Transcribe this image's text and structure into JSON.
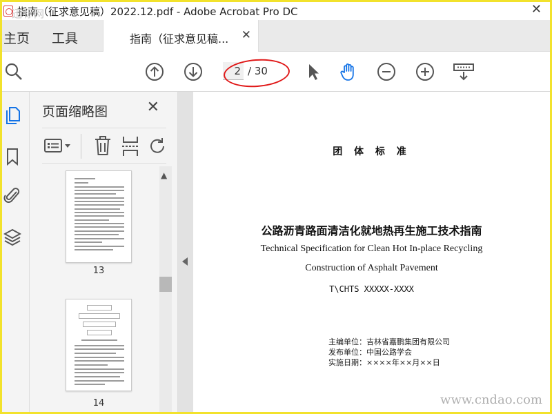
{
  "window": {
    "title": "指南（征求意见稿）2022.12.pdf - Adobe Acrobat Pro DC",
    "close_glyph": "✕",
    "watermark_top": "迅标网"
  },
  "tabs": {
    "home": "主页",
    "tools": "工具",
    "document": "指南（征求意见稿...",
    "close_glyph": "✕"
  },
  "toolbar": {
    "page_current": "2",
    "page_total": "/ 30"
  },
  "panel": {
    "title": "页面缩略图",
    "close_glyph": "✕",
    "thumbnails": [
      {
        "label": "13"
      },
      {
        "label": "14"
      }
    ]
  },
  "document": {
    "standard_type": "团 体 标 准",
    "title_cn": "公路沥青路面清洁化就地热再生施工技术指南",
    "title_en_line1": "Technical Specification for Clean Hot In-place Recycling",
    "title_en_line2": "Construction of Asphalt Pavement",
    "code": "T\\CHTS XXXXX-XXXX",
    "editor": "主编单位：吉林省嘉鹏集团有限公司",
    "publisher": "发布单位：中国公路学会",
    "effective_date": "实施日期：××××年××月××日"
  },
  "watermark_bottom": "www.cndao.com",
  "colors": {
    "accent_blue": "#1473e6",
    "annotation_red": "#e01818",
    "frame_yellow": "#f2e22c"
  }
}
